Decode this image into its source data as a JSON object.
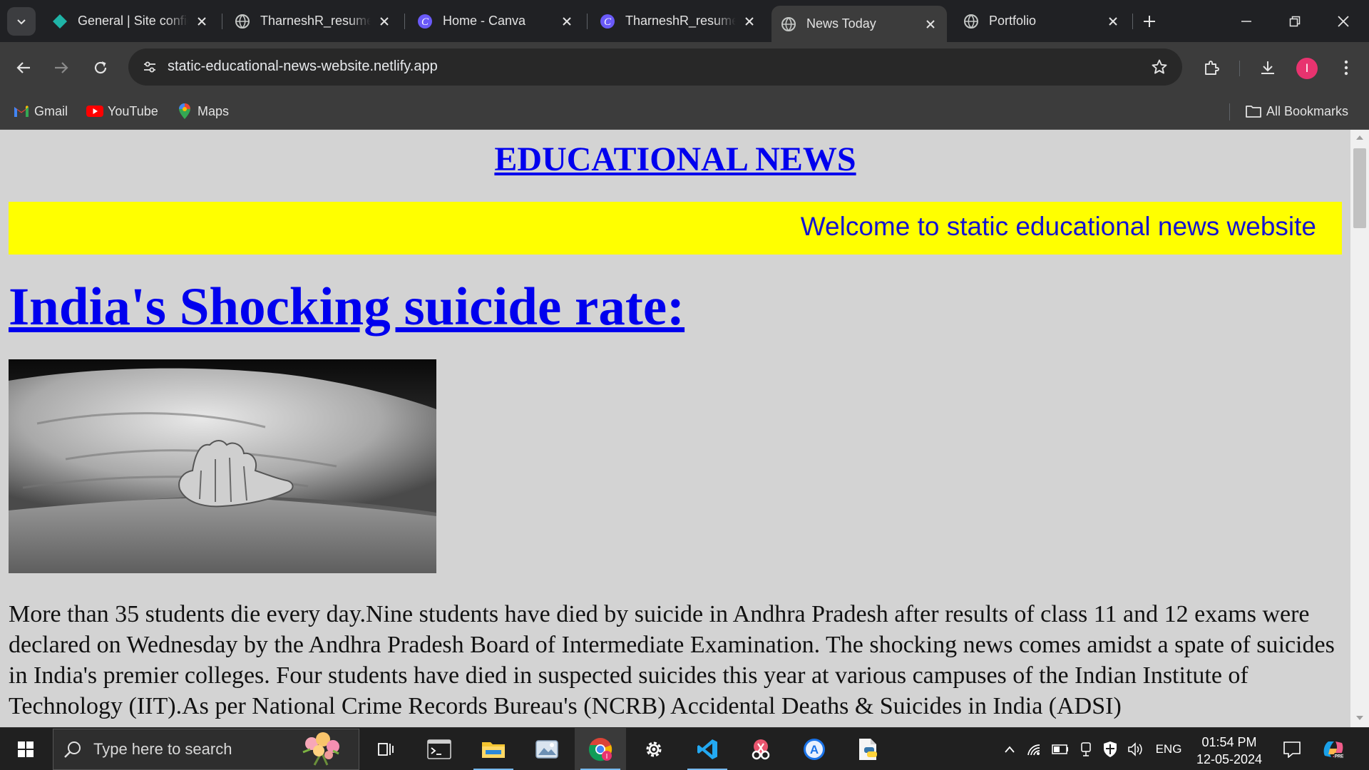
{
  "browser": {
    "tabs": [
      {
        "title": "General | Site configuration",
        "favicon": "netlify-icon",
        "active": false
      },
      {
        "title": "TharneshR_resume",
        "favicon": "globe-icon",
        "active": false
      },
      {
        "title": "Home - Canva",
        "favicon": "canva-icon",
        "active": false
      },
      {
        "title": "TharneshR_resume",
        "favicon": "canva-icon",
        "active": false
      },
      {
        "title": "News Today",
        "favicon": "globe-icon",
        "active": true
      },
      {
        "title": "Portfolio",
        "favicon": "globe-icon",
        "active": false
      }
    ],
    "url": "static-educational-news-website.netlify.app",
    "profile_initial": "I",
    "bookmarks": [
      {
        "label": "Gmail",
        "icon": "gmail-icon"
      },
      {
        "label": "YouTube",
        "icon": "youtube-icon"
      },
      {
        "label": "Maps",
        "icon": "maps-icon"
      }
    ],
    "all_bookmarks_label": "All Bookmarks"
  },
  "page": {
    "site_title": "EDUCATIONAL NEWS",
    "marquee_text": "Welcome to static educational news website",
    "headline": "India's Shocking suicide rate:",
    "image_alt": "black and white photo of a hand emerging from under a white sheet",
    "article_text": "More than 35 students die every day.Nine students have died by suicide in Andhra Pradesh after results of class 11 and 12 exams were declared on Wednesday by the Andhra Pradesh Board of Intermediate Examination. The shocking news comes amidst a spate of suicides in India's premier colleges. Four students have died in suspected suicides this year at various campuses of the Indian Institute of Technology (IIT).As per National Crime Records Bureau's (NCRB) Accidental Deaths & Suicides in India (ADSI)",
    "colors": {
      "background": "#d3d3d3",
      "link": "#0000ee",
      "marquee_bg": "#ffff00",
      "marquee_text": "#1414d2"
    }
  },
  "taskbar": {
    "search_placeholder": "Type here to search",
    "tray": {
      "language": "ENG",
      "time": "01:54 PM",
      "date": "12-05-2024"
    }
  }
}
